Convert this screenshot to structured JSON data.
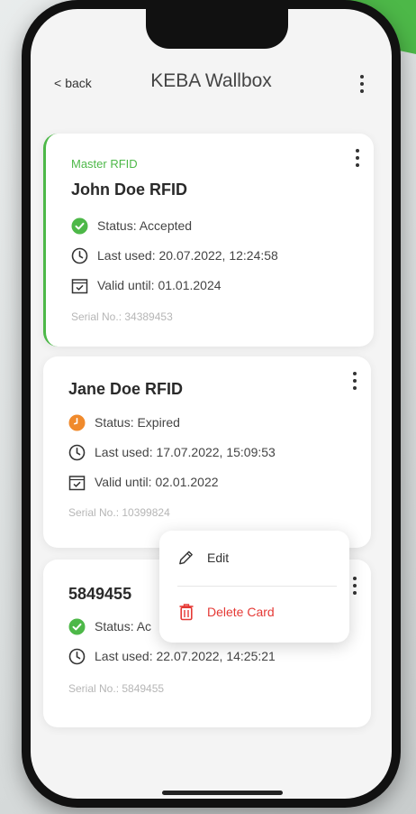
{
  "header": {
    "back_label": "back",
    "title": "KEBA Wallbox"
  },
  "cards": [
    {
      "master_label": "Master RFID",
      "title": "John Doe RFID",
      "status": "Status: Accepted",
      "status_color": "#4db848",
      "last_used": "Last used: 20.07.2022, 12:24:58",
      "valid_until": "Valid until: 01.01.2024",
      "serial": "Serial No.: 34389453"
    },
    {
      "title": "Jane Doe RFID",
      "status": "Status: Expired",
      "status_color": "#f08a2c",
      "last_used": "Last used: 17.07.2022, 15:09:53",
      "valid_until": "Valid until: 02.01.2022",
      "serial": "Serial No.: 10399824"
    },
    {
      "title": "5849455",
      "status": "Status: Ac",
      "status_color": "#4db848",
      "last_used": "Last used: 22.07.2022, 14:25:21",
      "serial": "Serial No.: 5849455"
    }
  ],
  "context_menu": {
    "edit_label": "Edit",
    "delete_label": "Delete Card"
  },
  "colors": {
    "accent": "#4db848",
    "warning": "#f08a2c",
    "danger": "#e53935"
  }
}
